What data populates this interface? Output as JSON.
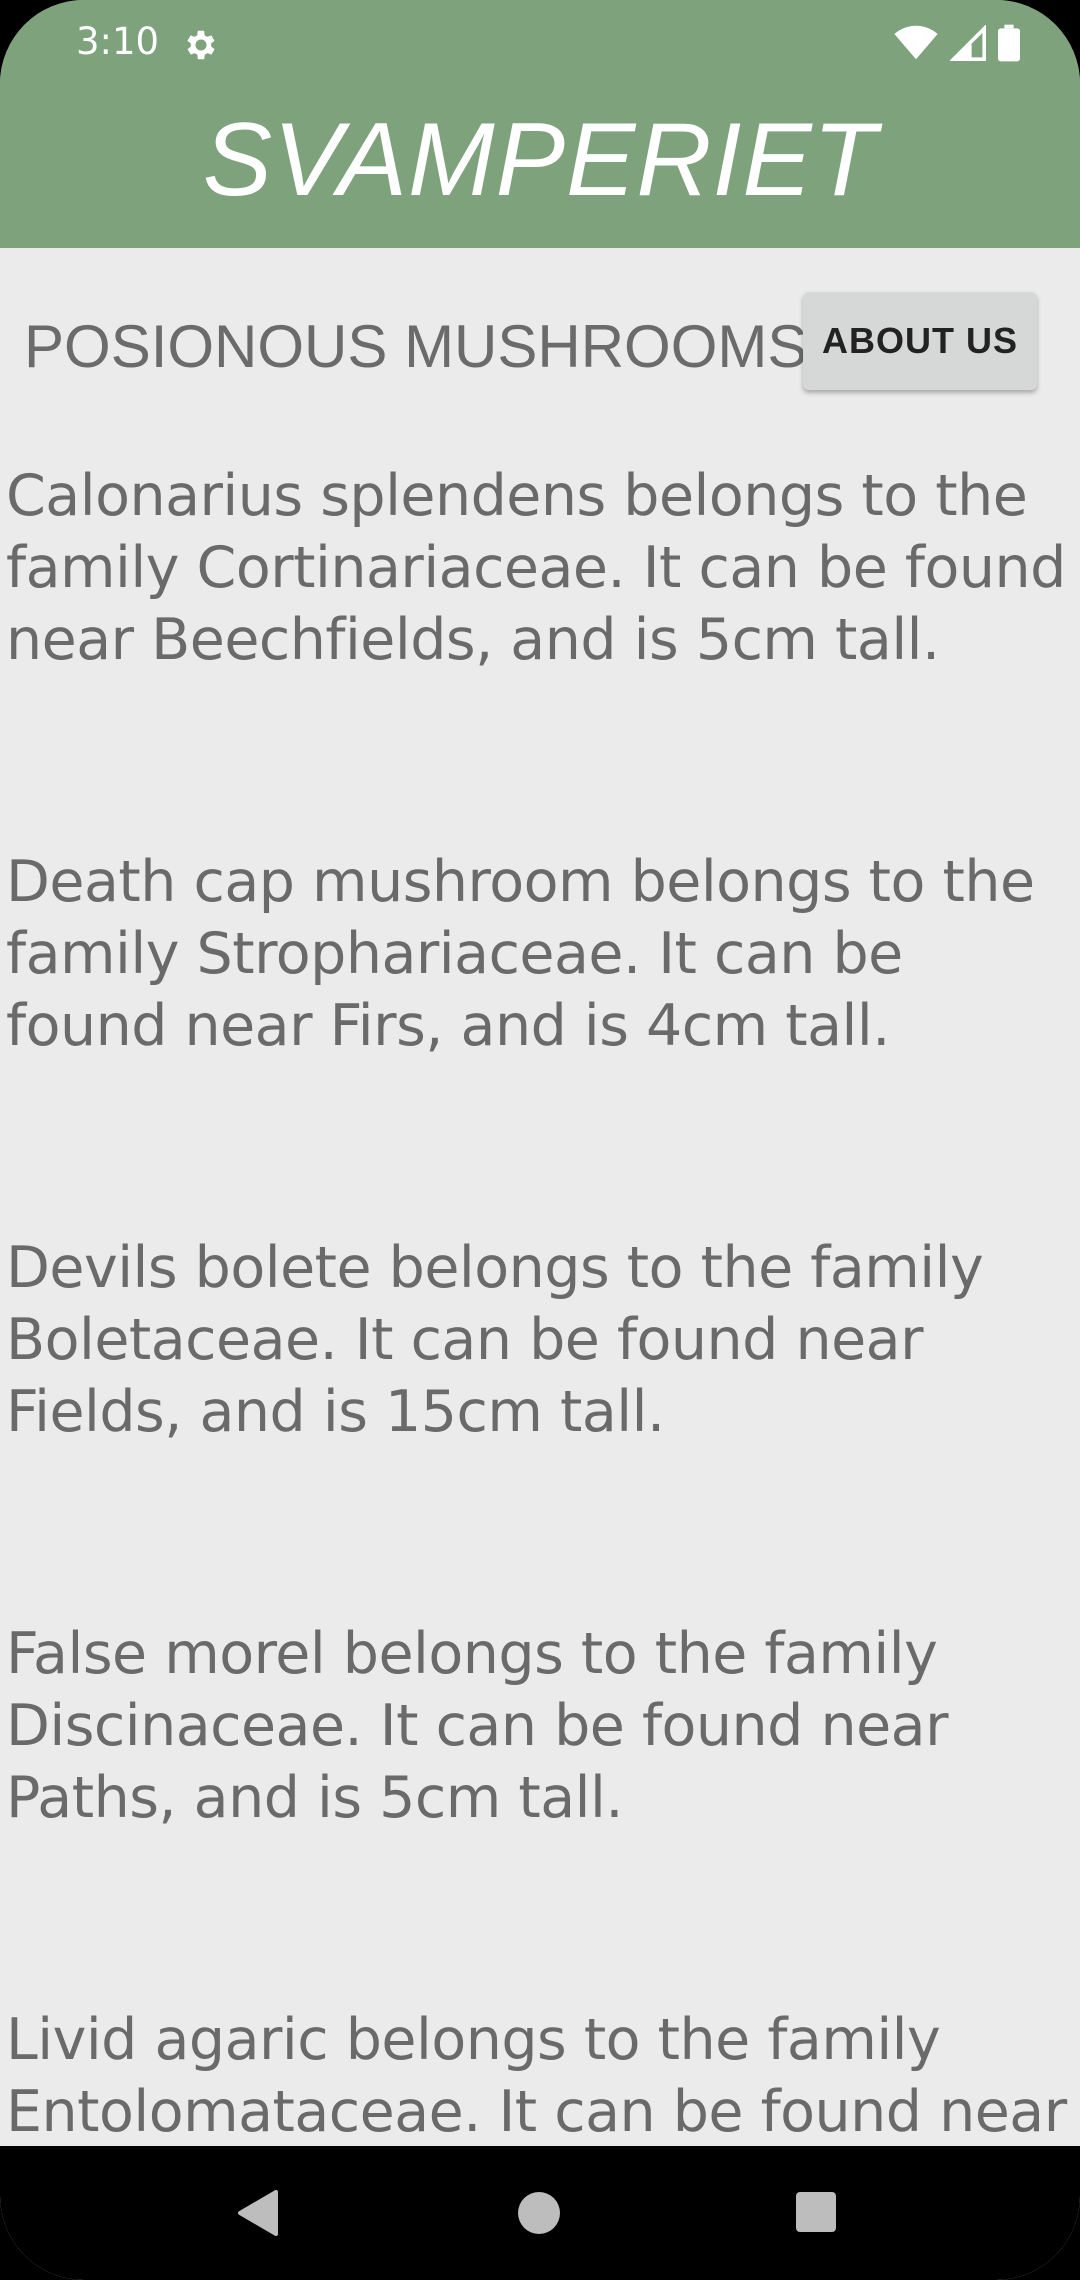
{
  "status_bar": {
    "time": "3:10",
    "icons": [
      "gear-icon",
      "wifi-icon",
      "signal-icon",
      "battery-icon"
    ]
  },
  "header": {
    "title": "SVAMPERIET"
  },
  "section": {
    "title": "POSIONOUS MUSHROOMS",
    "about_button_label": "ABOUT US"
  },
  "mushrooms": [
    {
      "text": "Calonarius splendens belongs to the family Cortinariaceae. It can be found near Beechfields, and is 5cm tall."
    },
    {
      "text": "Death cap mushroom belongs to the family Strophariaceae. It can be found near Firs, and is 4cm tall."
    },
    {
      "text": "Devils bolete belongs to the family Boletaceae. It can be found near Fields, and is 15cm tall."
    },
    {
      "text": "False morel belongs to the family Discinaceae. It can be found near Paths, and is 5cm tall."
    },
    {
      "text": "Livid agaric belongs to the family Entolomataceae. It can be found near"
    }
  ],
  "nav": {
    "icons": [
      "back-icon",
      "home-icon",
      "recents-icon"
    ]
  },
  "colors": {
    "header_bg": "#7da27c",
    "screen_bg": "#ebebeb",
    "text": "#6a6a6a",
    "button_bg": "#d6d7d7"
  }
}
